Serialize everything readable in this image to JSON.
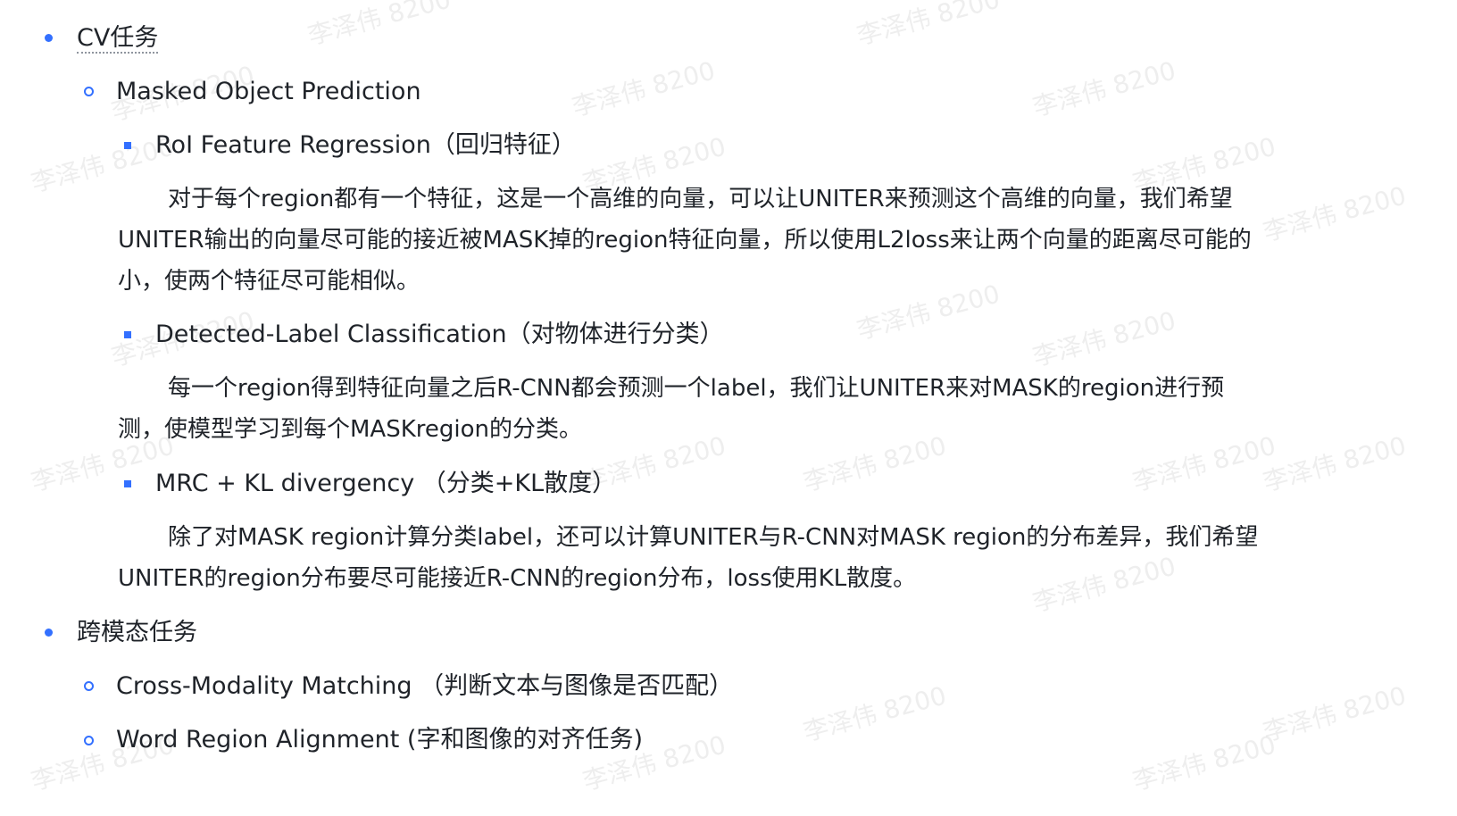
{
  "watermark_text": "李泽伟 8200",
  "sections": [
    {
      "title": "CV任务",
      "items": [
        {
          "label": "Masked Object Prediction",
          "subitems": [
            {
              "label": "RoI Feature Regression（回归特征）",
              "paragraph": [
                "对于每个region都有一个特征，这是一个高维的向量，可以让UNITER来预测这个高维的向量，我们希望",
                "UNITER输出的向量尽可能的接近被MASK掉的region特征向量，所以使用L2loss来让两个向量的距离尽可能的",
                "小，使两个特征尽可能相似。"
              ]
            },
            {
              "label": "Detected-Label Classification（对物体进行分类）",
              "paragraph": [
                "每一个region得到特征向量之后R-CNN都会预测一个label，我们让UNITER来对MASK的region进行预",
                "测，使模型学习到每个MASKregion的分类。"
              ]
            },
            {
              "label": "MRC + KL divergency （分类+KL散度）",
              "paragraph": [
                "除了对MASK region计算分类label，还可以计算UNITER与R-CNN对MASK region的分布差异，我们希望",
                "UNITER的region分布要尽可能接近R-CNN的region分布，loss使用KL散度。"
              ]
            }
          ]
        }
      ]
    },
    {
      "title": "跨模态任务",
      "items": [
        {
          "label": "Cross-Modality Matching （判断文本与图像是否匹配）"
        },
        {
          "label": "Word Region Alignment (字和图像的对齐任务)"
        }
      ]
    }
  ],
  "colors": {
    "bullet": "#3370ff",
    "text": "#1f2329",
    "watermark": "#969696"
  }
}
